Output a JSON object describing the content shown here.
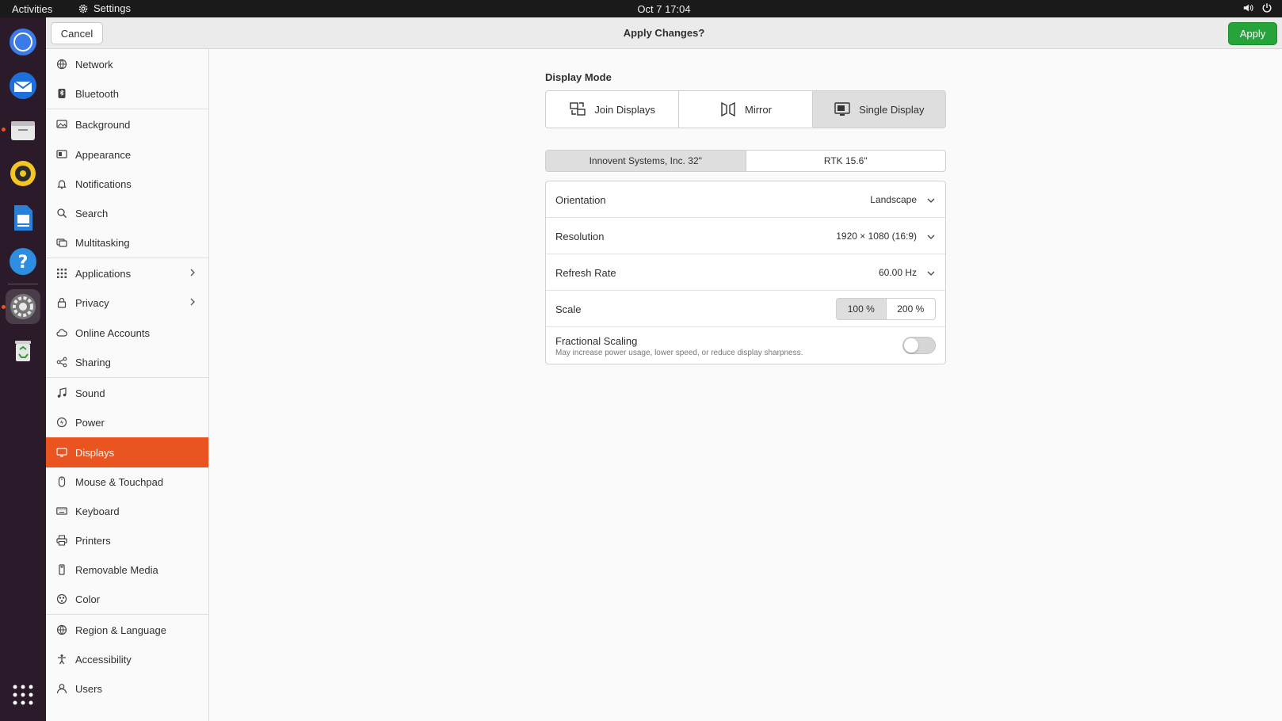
{
  "topbar": {
    "activities": "Activities",
    "app_name": "Settings",
    "clock": "Oct 7  17:04",
    "volume_icon": "volume-icon",
    "power_icon": "power-icon"
  },
  "dock": {
    "items": [
      {
        "name": "chromium-icon"
      },
      {
        "name": "thunderbird-icon"
      },
      {
        "name": "files-icon"
      },
      {
        "name": "rhythmbox-icon"
      },
      {
        "name": "writer-icon"
      },
      {
        "name": "help-icon"
      },
      {
        "name": "settings-icon"
      },
      {
        "name": "trash-icon"
      },
      {
        "name": "app-grid-icon"
      }
    ]
  },
  "header": {
    "cancel": "Cancel",
    "title": "Apply Changes?",
    "apply": "Apply"
  },
  "sidebar": {
    "items": [
      {
        "label": "Network",
        "icon": "network-icon"
      },
      {
        "label": "Bluetooth",
        "icon": "bluetooth-icon"
      },
      {
        "label": "Background",
        "icon": "background-icon"
      },
      {
        "label": "Appearance",
        "icon": "appearance-icon"
      },
      {
        "label": "Notifications",
        "icon": "bell-icon"
      },
      {
        "label": "Search",
        "icon": "search-icon"
      },
      {
        "label": "Multitasking",
        "icon": "multitasking-icon"
      },
      {
        "label": "Applications",
        "icon": "apps-icon"
      },
      {
        "label": "Privacy",
        "icon": "lock-icon"
      },
      {
        "label": "Online Accounts",
        "icon": "cloud-icon"
      },
      {
        "label": "Sharing",
        "icon": "share-icon"
      },
      {
        "label": "Sound",
        "icon": "music-icon"
      },
      {
        "label": "Power",
        "icon": "power-icon"
      },
      {
        "label": "Displays",
        "icon": "display-icon"
      },
      {
        "label": "Mouse & Touchpad",
        "icon": "mouse-icon"
      },
      {
        "label": "Keyboard",
        "icon": "keyboard-icon"
      },
      {
        "label": "Printers",
        "icon": "printer-icon"
      },
      {
        "label": "Removable Media",
        "icon": "usb-icon"
      },
      {
        "label": "Color",
        "icon": "color-icon"
      },
      {
        "label": "Region & Language",
        "icon": "globe-icon"
      },
      {
        "label": "Accessibility",
        "icon": "accessibility-icon"
      },
      {
        "label": "Users",
        "icon": "user-icon"
      }
    ],
    "selected": "Displays"
  },
  "display_mode": {
    "label": "Display Mode",
    "options": [
      "Join Displays",
      "Mirror",
      "Single Display"
    ],
    "selected": "Single Display"
  },
  "monitors": {
    "options": [
      "Innovent Systems, Inc. 32\"",
      "RTK 15.6\""
    ],
    "selected": "Innovent Systems, Inc. 32\""
  },
  "properties": {
    "orientation": {
      "label": "Orientation",
      "value": "Landscape"
    },
    "resolution": {
      "label": "Resolution",
      "value": "1920 × 1080 (16:9)"
    },
    "refresh_rate": {
      "label": "Refresh Rate",
      "value": "60.00 Hz"
    },
    "scale": {
      "label": "Scale",
      "options": [
        "100 %",
        "200 %"
      ],
      "selected": "100 %"
    },
    "fractional_scaling": {
      "label": "Fractional Scaling",
      "description": "May increase power usage, lower speed, or reduce display sharpness.",
      "enabled": false
    }
  },
  "colors": {
    "accent": "#e95420",
    "apply_green": "#26a33a",
    "topbar": "#1a1a1a",
    "dock": "#2b1a2a"
  }
}
